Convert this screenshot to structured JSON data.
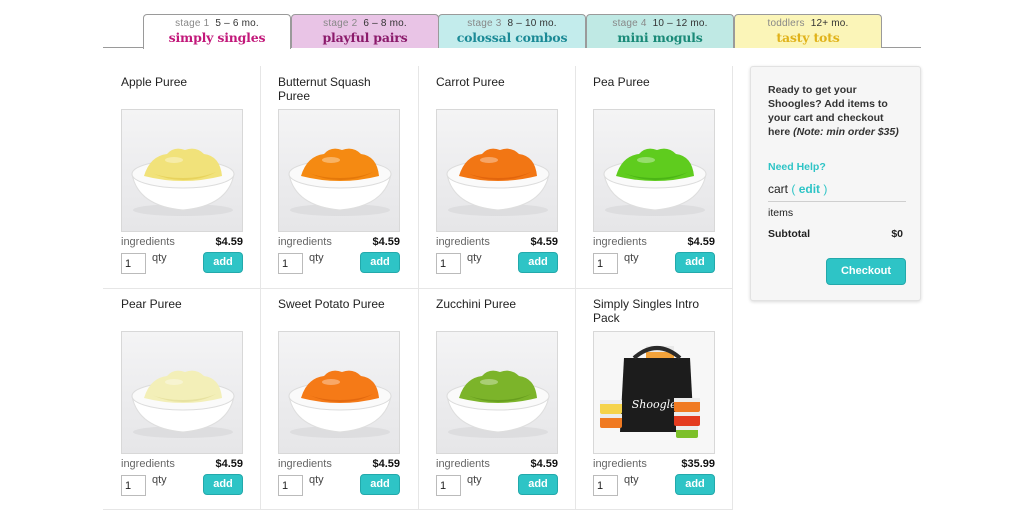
{
  "tabs": [
    {
      "stage": "stage 1",
      "age": "5 – 6 mo.",
      "title": "simply singles",
      "bg": "#ffffff",
      "title_color": "#c2187a",
      "active": true
    },
    {
      "stage": "stage 2",
      "age": "6 – 8 mo.",
      "title": "playful pairs",
      "bg": "#e9c4e6",
      "title_color": "#8b1a6b",
      "active": false
    },
    {
      "stage": "stage 3",
      "age": "8 – 10 mo.",
      "title": "colossal combos",
      "bg": "#c3ecec",
      "title_color": "#1b8a96",
      "active": false
    },
    {
      "stage": "stage 4",
      "age": "10 – 12 mo.",
      "title": "mini moguls",
      "bg": "#bfe9e4",
      "title_color": "#1a8a78",
      "active": false
    },
    {
      "stage": "toddlers",
      "age": "12+ mo.",
      "title": "tasty tots",
      "bg": "#fbf5b8",
      "title_color": "#e0b21a",
      "active": false
    }
  ],
  "products": [
    {
      "name": "Apple Puree",
      "ingredients_label": "ingredients",
      "price": "$4.59",
      "qty": "1",
      "qty_label": "qty",
      "add_label": "add",
      "image": "puree-bowl",
      "puree_color": "#f1e27a",
      "puree_shade": "#e3c94a"
    },
    {
      "name": "Butternut Squash Puree",
      "ingredients_label": "ingredients",
      "price": "$4.59",
      "qty": "1",
      "qty_label": "qty",
      "add_label": "add",
      "image": "puree-bowl",
      "puree_color": "#f58a12",
      "puree_shade": "#d96c05"
    },
    {
      "name": "Carrot Puree",
      "ingredients_label": "ingredients",
      "price": "$4.59",
      "qty": "1",
      "qty_label": "qty",
      "add_label": "add",
      "image": "puree-bowl",
      "puree_color": "#f27614",
      "puree_shade": "#d75a08"
    },
    {
      "name": "Pea Puree",
      "ingredients_label": "ingredients",
      "price": "$4.59",
      "qty": "1",
      "qty_label": "qty",
      "add_label": "add",
      "image": "puree-bowl",
      "puree_color": "#5fcc1e",
      "puree_shade": "#3ea510"
    },
    {
      "name": "Pear Puree",
      "ingredients_label": "ingredients",
      "price": "$4.59",
      "qty": "1",
      "qty_label": "qty",
      "add_label": "add",
      "image": "puree-bowl",
      "puree_color": "#f3efb8",
      "puree_shade": "#e0d98f"
    },
    {
      "name": "Sweet Potato Puree",
      "ingredients_label": "ingredients",
      "price": "$4.59",
      "qty": "1",
      "qty_label": "qty",
      "add_label": "add",
      "image": "puree-bowl",
      "puree_color": "#f57a17",
      "puree_shade": "#d75e0a"
    },
    {
      "name": "Zucchini Puree",
      "ingredients_label": "ingredients",
      "price": "$4.59",
      "qty": "1",
      "qty_label": "qty",
      "add_label": "add",
      "image": "puree-bowl",
      "puree_color": "#7cb42a",
      "puree_shade": "#5a8f18"
    },
    {
      "name": "Simply Singles Intro Pack",
      "ingredients_label": "ingredients",
      "price": "$35.99",
      "qty": "1",
      "qty_label": "qty",
      "add_label": "add",
      "image": "cooler-bag-with-containers",
      "puree_color": "#222222",
      "puree_shade": "#111111"
    }
  ],
  "cart": {
    "ready_text": "Ready to get your Shoogles? Add items to your cart and checkout here",
    "note": "(Note: min order $35)",
    "help": "Need Help?",
    "cart_label": "cart",
    "edit_label": "edit",
    "items_label": "items",
    "subtotal_label": "Subtotal",
    "subtotal_value": "$0",
    "checkout_label": "Checkout"
  },
  "colors": {
    "accent": "#2ec4c6"
  }
}
